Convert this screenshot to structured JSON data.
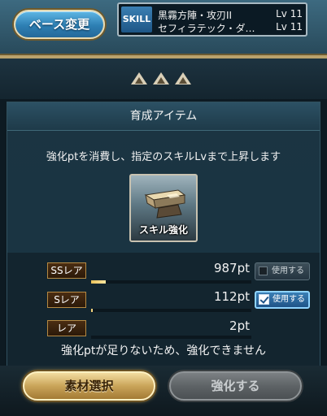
{
  "header": {
    "base_change_label": "ベース変更",
    "skill_tag": "SKILL",
    "skills": [
      {
        "name": "黒霧方陣・攻刃II",
        "level": "Lv 11"
      },
      {
        "name": "セフィラテック・ダ…",
        "level": "Lv 11"
      }
    ]
  },
  "panel": {
    "title": "育成アイテム",
    "description": "強化ptを消費し、指定のスキルLvまで上昇します",
    "item_label": "スキル強化",
    "item_icon": "anvil-icon"
  },
  "rarities": [
    {
      "label": "SSレア",
      "points": "987pt",
      "bar_fraction": 0.09,
      "use_label": "使用する",
      "use_checked": false
    },
    {
      "label": "Sレア",
      "points": "112pt",
      "bar_fraction": 0.01,
      "use_label": "使用する",
      "use_checked": true
    },
    {
      "label": "レア",
      "points": "2pt",
      "bar_fraction": 0.0,
      "use_label": "",
      "use_checked": false
    }
  ],
  "warning": "強化ptが足りないため、強化できません",
  "buttons": {
    "select_material": "素材選択",
    "enhance": "強化する"
  },
  "colors": {
    "accent_gold": "#caa55a",
    "base_button_blue": "#2d7fb3",
    "use_checked_blue": "#3a7fb5",
    "disabled_gray": "#5e6366"
  }
}
